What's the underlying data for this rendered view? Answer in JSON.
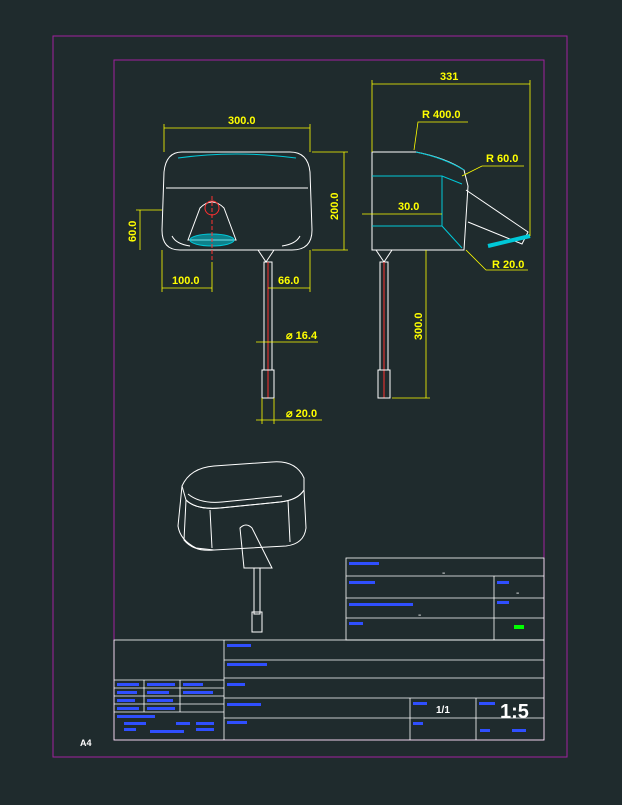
{
  "sheet": {
    "size_label": "A4"
  },
  "colors": {
    "background": "#1f2b2d",
    "frame": "#a020a0",
    "dimension": "#ffff00",
    "outline": "#ffffff",
    "accent": "#00c8d8",
    "red": "#ff3030",
    "blue_text": "#2f4fff",
    "green_mark": "#00ff00"
  },
  "front_view": {
    "dims": {
      "width": "300.0",
      "height": "200.0",
      "left_height": "60.0",
      "bottom_left": "100.0",
      "bottom_right": "66.0",
      "stem_dia": "⌀ 16.4",
      "foot_dia": "⌀ 20.0"
    }
  },
  "side_view": {
    "dims": {
      "overall": "331",
      "r_top": "R 400.0",
      "r_mid": "R 60.0",
      "r_low": "R 20.0",
      "inner": "30.0",
      "stem_length": "300.0"
    }
  },
  "title_block": {
    "dash_1": "-",
    "dash_2": "-",
    "dash_3": "-",
    "sheet_fraction": "1/1",
    "scale": "1:5"
  }
}
